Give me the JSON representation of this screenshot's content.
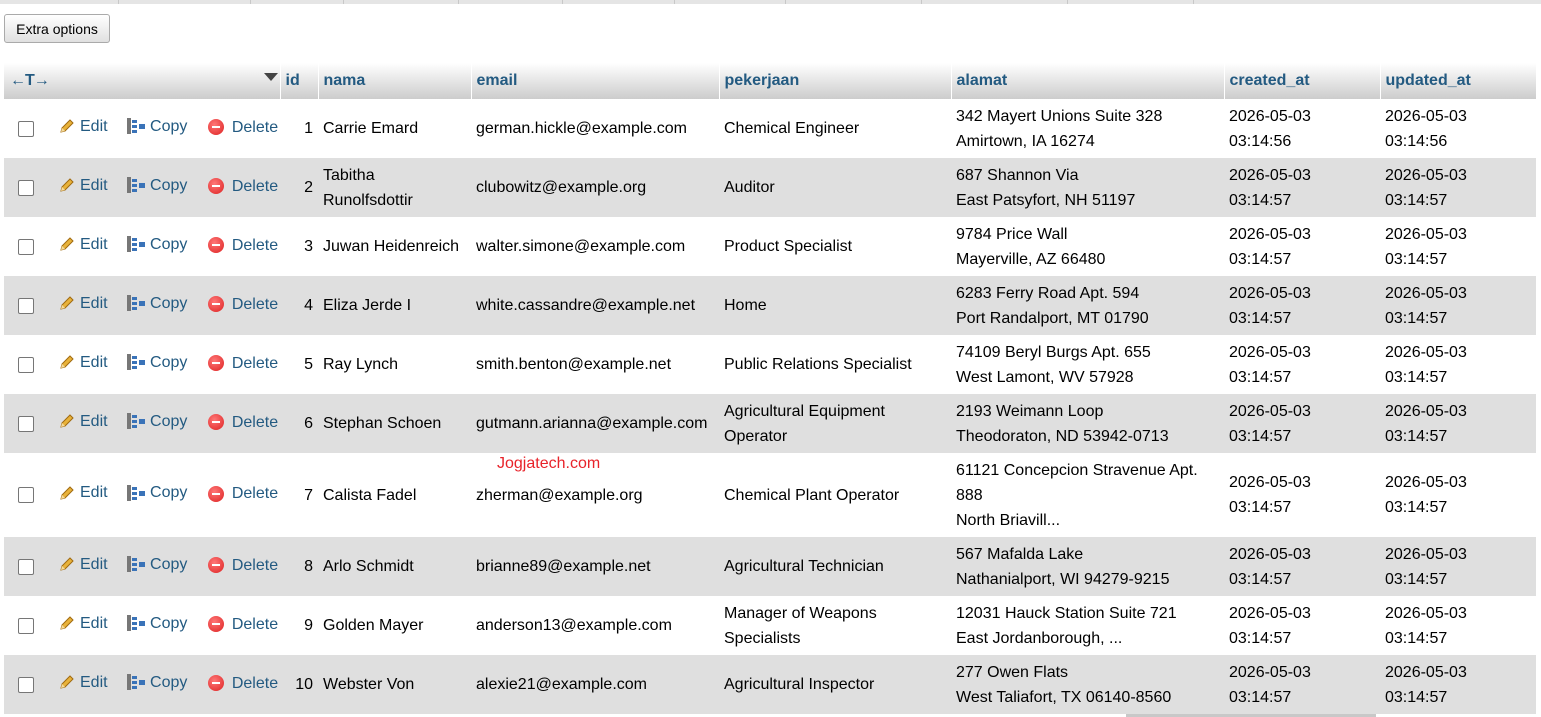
{
  "toolbar": {
    "extra_options_label": "Extra options"
  },
  "table": {
    "columns": [
      "id",
      "nama",
      "email",
      "pekerjaan",
      "alamat",
      "created_at",
      "updated_at"
    ],
    "action_labels": {
      "edit": "Edit",
      "copy": "Copy",
      "delete": "Delete"
    },
    "rows": [
      {
        "id": "1",
        "nama": "Carrie Emard",
        "email": "german.hickle@example.com",
        "pekerjaan": "Chemical Engineer",
        "alamat": "342 Mayert Unions Suite 328\nAmirtown, IA 16274",
        "created_at": "2026-05-03\n03:14:56",
        "updated_at": "2026-05-03\n03:14:56"
      },
      {
        "id": "2",
        "nama": "Tabitha\nRunolfsdottir",
        "email": "clubowitz@example.org",
        "pekerjaan": "Auditor",
        "alamat": "687 Shannon Via\nEast Patsyfort, NH 51197",
        "created_at": "2026-05-03\n03:14:57",
        "updated_at": "2026-05-03\n03:14:57"
      },
      {
        "id": "3",
        "nama": "Juwan Heidenreich",
        "email": "walter.simone@example.com",
        "pekerjaan": "Product Specialist",
        "alamat": "9784 Price Wall\nMayerville, AZ 66480",
        "created_at": "2026-05-03\n03:14:57",
        "updated_at": "2026-05-03\n03:14:57"
      },
      {
        "id": "4",
        "nama": "Eliza Jerde I",
        "email": "white.cassandre@example.net",
        "pekerjaan": "Home",
        "alamat": "6283 Ferry Road Apt. 594\nPort Randalport, MT 01790",
        "created_at": "2026-05-03\n03:14:57",
        "updated_at": "2026-05-03\n03:14:57"
      },
      {
        "id": "5",
        "nama": "Ray Lynch",
        "email": "smith.benton@example.net",
        "pekerjaan": "Public Relations Specialist",
        "alamat": "74109 Beryl Burgs Apt. 655\nWest Lamont, WV 57928",
        "created_at": "2026-05-03\n03:14:57",
        "updated_at": "2026-05-03\n03:14:57"
      },
      {
        "id": "6",
        "nama": "Stephan Schoen",
        "email": "gutmann.arianna@example.com",
        "pekerjaan": "Agricultural Equipment\nOperator",
        "alamat": "2193 Weimann Loop\nTheodoraton, ND 53942-0713",
        "created_at": "2026-05-03\n03:14:57",
        "updated_at": "2026-05-03\n03:14:57"
      },
      {
        "id": "7",
        "nama": "Calista Fadel",
        "email": "zherman@example.org",
        "pekerjaan": "Chemical Plant Operator",
        "alamat": "61121 Concepcion Stravenue Apt.\n888\nNorth Briavill...",
        "created_at": "2026-05-03\n03:14:57",
        "updated_at": "2026-05-03\n03:14:57"
      },
      {
        "id": "8",
        "nama": "Arlo Schmidt",
        "email": "brianne89@example.net",
        "pekerjaan": "Agricultural Technician",
        "alamat": "567 Mafalda Lake\nNathanialport, WI 94279-9215",
        "created_at": "2026-05-03\n03:14:57",
        "updated_at": "2026-05-03\n03:14:57"
      },
      {
        "id": "9",
        "nama": "Golden Mayer",
        "email": "anderson13@example.com",
        "pekerjaan": "Manager of Weapons\nSpecialists",
        "alamat": "12031 Hauck Station Suite 721\nEast Jordanborough, ...",
        "created_at": "2026-05-03\n03:14:57",
        "updated_at": "2026-05-03\n03:14:57"
      },
      {
        "id": "10",
        "nama": "Webster Von",
        "email": "alexie21@example.com",
        "pekerjaan": "Agricultural Inspector",
        "alamat": "277 Owen Flats\nWest Taliafort, TX 06140-8560",
        "created_at": "2026-05-03\n03:14:57",
        "updated_at": "2026-05-03\n03:14:57"
      }
    ]
  },
  "watermark": "Jogjatech.com",
  "colors": {
    "link": "#235a81",
    "row_even": "#dfdfdf",
    "delete_icon": "#dd2222",
    "watermark": "#e8232a"
  }
}
